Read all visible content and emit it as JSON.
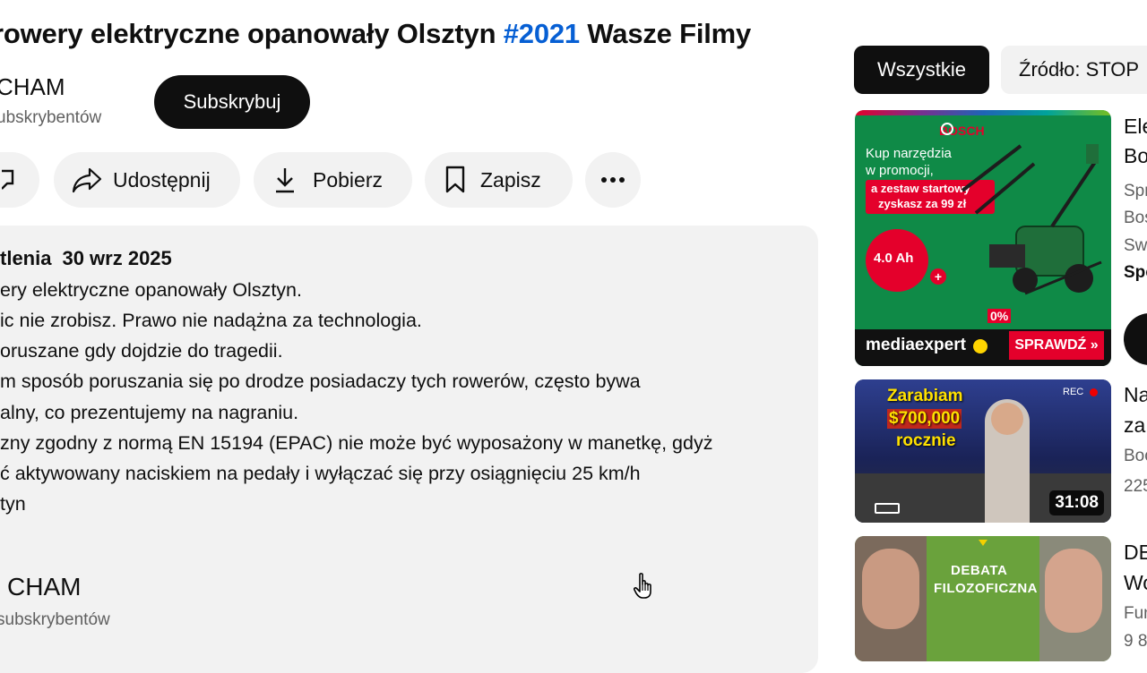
{
  "video": {
    "title_main": "rowery elektryczne opanowały Olsztyn ",
    "title_hashtag": "#2021",
    "title_tail": " Wasze Filmy",
    "channel_name": "CHAM",
    "subscriber_count": "ubskrybentów",
    "subscribe_label": "Subskrybuj"
  },
  "actions": {
    "share_label": "Udostępnij",
    "download_label": "Pobierz",
    "save_label": "Zapisz"
  },
  "description": {
    "views_fragment": "tlenia",
    "date": "30 wrz 2025",
    "lines": [
      "ery elektryczne opanowały Olsztyn.",
      "ic nie zrobisz. Prawo nie nadążna za technologia.",
      "oruszane gdy dojdzie do tragedii.",
      "m sposób poruszania się po drodze posiadaczy tych rowerów, często bywa",
      "alny, co prezentujemy na nagraniu.",
      "zny zgodny z normą EN 15194 (EPAC) nie może być wyposażony w manetkę, gdyż",
      "ć aktywowany naciskiem na pedały i wyłączać się przy osiągnięciu 25 km/h",
      "tyn"
    ],
    "channel_name": "CHAM",
    "subscriber_count": "subskrybentów"
  },
  "sidebar": {
    "chips": {
      "all": "Wszystkie",
      "source": "Źródło: STOP"
    },
    "items": [
      {
        "thumb": {
          "brand": "BOSCH",
          "line1": "Kup narzędzia",
          "line2": "w promocji,",
          "promo1": "a zestaw startowy",
          "promo2": "zyskasz za 99 zł",
          "battery": "4.0 Ah",
          "percent": "0%",
          "store": "mediaexpert",
          "cta": "SPRAWDŹ »"
        },
        "title1": "Ele",
        "title2": "Bo",
        "meta1": "Spr",
        "meta2": "Bos",
        "meta3": "Sw",
        "sponsor": "Spo"
      },
      {
        "thumb": {
          "line1": "Zarabiam",
          "line2": "$700,000",
          "line3": "rocznie",
          "rec": "REC"
        },
        "duration": "31:08",
        "title1": "Na",
        "title2": "za",
        "meta1": "Boo",
        "meta2": "225"
      },
      {
        "thumb": {
          "line1": "DEBATA",
          "line2": "FILOZOFICZNA"
        },
        "title1": "DE",
        "title2": "Wo",
        "meta1": "Fun",
        "meta2": "9 8"
      }
    ]
  },
  "colors": {
    "accent_link": "#065fd4",
    "pill_bg": "#f2f2f2",
    "text_primary": "#0f0f0f",
    "text_secondary": "#606060"
  }
}
